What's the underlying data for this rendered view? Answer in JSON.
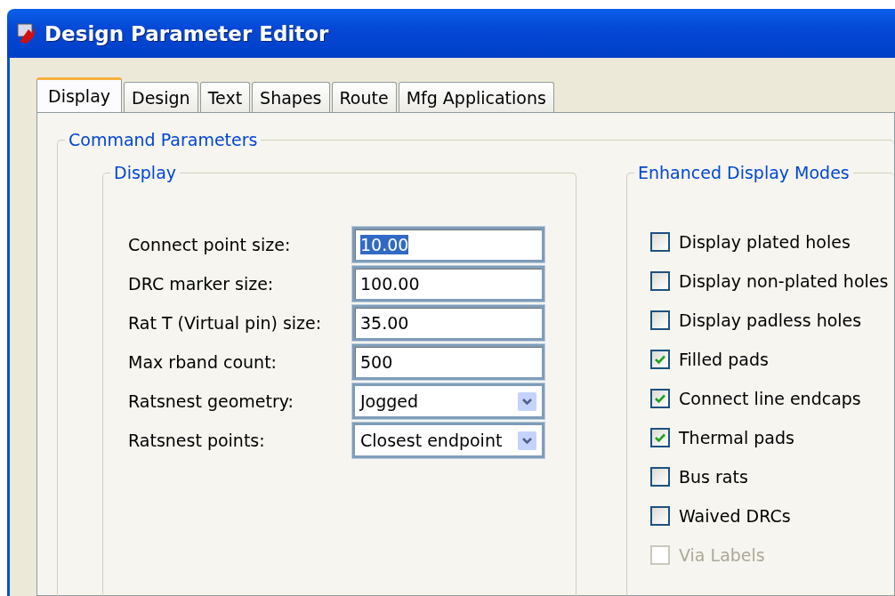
{
  "window": {
    "title": "Design Parameter Editor"
  },
  "tabs": [
    {
      "label": "Display",
      "selected": true
    },
    {
      "label": "Design",
      "selected": false
    },
    {
      "label": "Text",
      "selected": false
    },
    {
      "label": "Shapes",
      "selected": false
    },
    {
      "label": "Route",
      "selected": false
    },
    {
      "label": "Mfg Applications",
      "selected": false
    }
  ],
  "command_parameters": {
    "title": "Command Parameters",
    "display": {
      "title": "Display",
      "fields": [
        {
          "label": "Connect point size:",
          "kind": "text",
          "value": "10.00",
          "text_selected": true
        },
        {
          "label": "DRC marker size:",
          "kind": "text",
          "value": "100.00",
          "text_selected": false
        },
        {
          "label": "Rat T (Virtual pin) size:",
          "kind": "text",
          "value": "35.00",
          "text_selected": false
        },
        {
          "label": "Max rband count:",
          "kind": "text",
          "value": "500",
          "text_selected": false
        },
        {
          "label": "Ratsnest geometry:",
          "kind": "dropdown",
          "value": "Jogged"
        },
        {
          "label": "Ratsnest points:",
          "kind": "dropdown",
          "value": "Closest endpoint"
        }
      ]
    },
    "enhanced_display_modes": {
      "title": "Enhanced Display Modes",
      "options": [
        {
          "label": "Display plated holes",
          "checked": false,
          "disabled": false
        },
        {
          "label": "Display non-plated holes",
          "checked": false,
          "disabled": false
        },
        {
          "label": "Display padless holes",
          "checked": false,
          "disabled": false
        },
        {
          "label": "Filled pads",
          "checked": true,
          "disabled": false
        },
        {
          "label": "Connect line endcaps",
          "checked": true,
          "disabled": false
        },
        {
          "label": "Thermal pads",
          "checked": true,
          "disabled": false
        },
        {
          "label": "Bus rats",
          "checked": false,
          "disabled": false
        },
        {
          "label": "Waived DRCs",
          "checked": false,
          "disabled": false
        },
        {
          "label": "Via Labels",
          "checked": false,
          "disabled": true
        }
      ]
    }
  }
}
